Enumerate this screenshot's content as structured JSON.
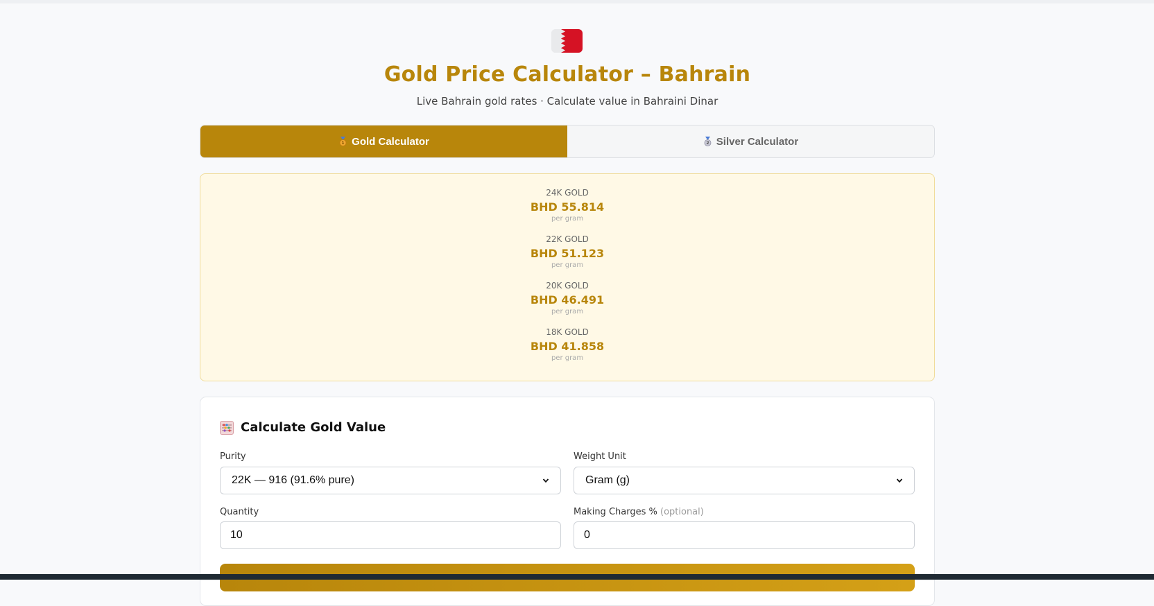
{
  "header": {
    "title": "Gold Price Calculator – Bahrain",
    "subtitle": "Live Bahrain gold rates · Calculate value in Bahraini Dinar",
    "flag_icon": "bahrain-flag-icon"
  },
  "tabs": [
    {
      "label": "Gold Calculator",
      "icon": "gold-medal-icon",
      "active": true
    },
    {
      "label": "Silver Calculator",
      "icon": "silver-medal-icon",
      "active": false
    }
  ],
  "rates": [
    {
      "label": "24K GOLD",
      "price": "BHD 55.814",
      "unit": "per gram"
    },
    {
      "label": "22K GOLD",
      "price": "BHD 51.123",
      "unit": "per gram"
    },
    {
      "label": "20K GOLD",
      "price": "BHD 46.491",
      "unit": "per gram"
    },
    {
      "label": "18K GOLD",
      "price": "BHD 41.858",
      "unit": "per gram"
    }
  ],
  "calculator": {
    "heading": "Calculate Gold Value",
    "heading_icon": "abacus-icon",
    "purity": {
      "label": "Purity",
      "value": "22K — 916 (91.6% pure)"
    },
    "weight_unit": {
      "label": "Weight Unit",
      "value": "Gram (g)"
    },
    "quantity": {
      "label": "Quantity",
      "value": "10"
    },
    "making_charges": {
      "label": "Making Charges %",
      "optional": "(optional)",
      "value": "0"
    }
  },
  "colors": {
    "accent": "#b8860b",
    "rates_bg": "#fff9e6",
    "bahrain_red": "#d51224"
  }
}
